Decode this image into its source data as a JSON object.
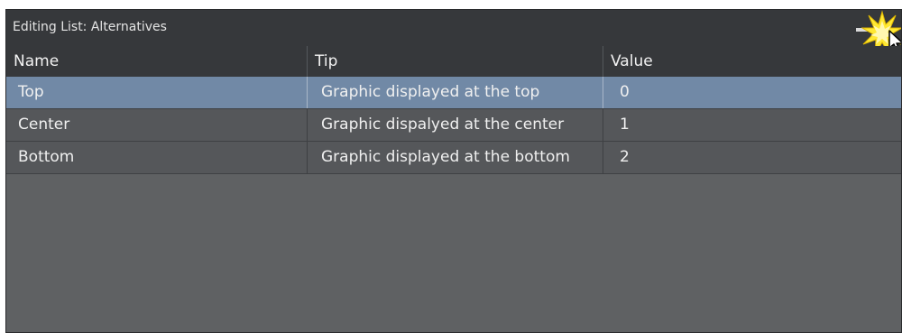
{
  "window": {
    "title": "Editing List: Alternatives"
  },
  "columns": {
    "name": "Name",
    "tip": "Tip",
    "value": "Value"
  },
  "rows": [
    {
      "name": "Top",
      "tip": "Graphic displayed at the top",
      "value": "0",
      "selected": true
    },
    {
      "name": "Center",
      "tip": "Graphic dispalyed at the center",
      "value": "1",
      "selected": false
    },
    {
      "name": "Bottom",
      "tip": "Graphic displayed at the bottom",
      "value": "2",
      "selected": false
    }
  ],
  "icons": {
    "minimize": "minimize-icon",
    "highlight": "click-burst-icon",
    "cursor": "mouse-cursor-icon"
  },
  "colors": {
    "titlebar": "#36383b",
    "panel": "#5f6163",
    "row": "#55575a",
    "selected_row": "#7189a6",
    "burst": "#ffe833"
  }
}
